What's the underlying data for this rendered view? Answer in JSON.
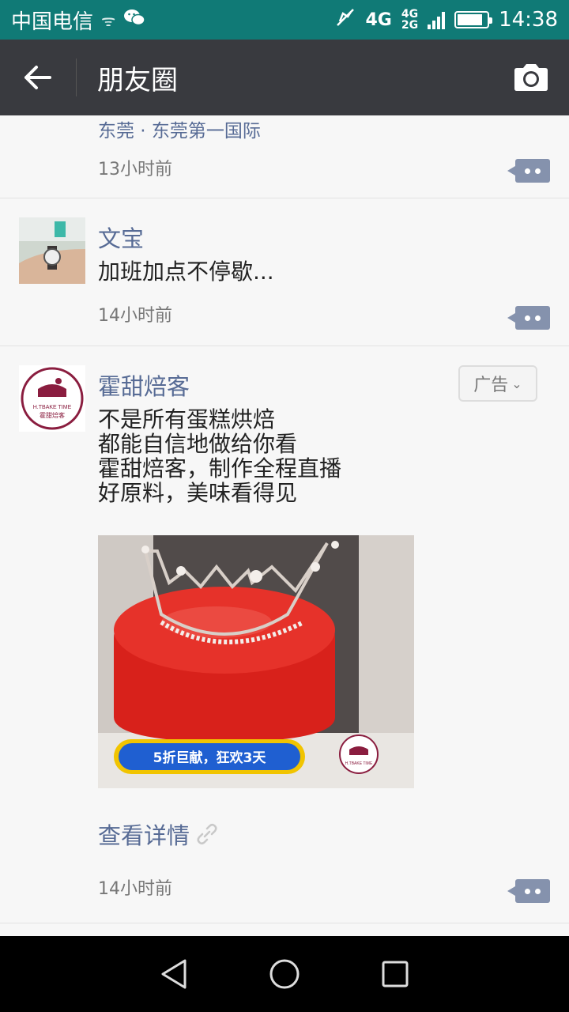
{
  "status_bar": {
    "carrier": "中国电信",
    "network_4g": "4G",
    "network_small_top": "4G",
    "network_small_bottom": "2G",
    "time": "14:38",
    "battery_level": 0.85
  },
  "title_bar": {
    "title": "朋友圈",
    "back_icon": "arrow-left-icon",
    "camera_icon": "camera-icon"
  },
  "posts": [
    {
      "location": "东莞 · 东莞第一国际",
      "time": "13小时前"
    },
    {
      "name": "文宝",
      "text": "加班加点不停歇...",
      "time": "14小时前"
    },
    {
      "name": "霍甜焙客",
      "ad_label": "广告",
      "text_lines": [
        "不是所有蛋糕烘焙",
        "都能自信地做给你看",
        "霍甜焙客，制作全程直播",
        "好原料，美味看得见"
      ],
      "avatar_text": "H.TBAKE TIME",
      "avatar_subtext": "霍甜焙客",
      "image_banner": "5折巨献，狂欢3天",
      "image_logo_text": "H.TBAKE TIME",
      "detail_link": "查看详情",
      "time": "14小时前"
    }
  ],
  "nav_bar": {
    "back_icon": "triangle-back-icon",
    "home_icon": "circle-home-icon",
    "recents_icon": "square-recents-icon"
  },
  "colors": {
    "status_bar": "#107a76",
    "title_bar": "#393a3f",
    "link_blue": "#576b95",
    "cake_red": "#d8211b"
  }
}
